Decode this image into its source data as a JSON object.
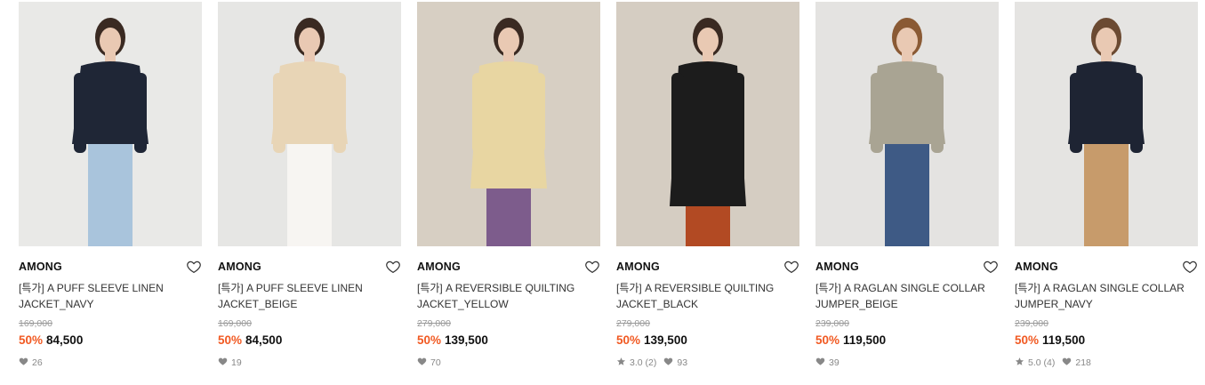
{
  "products": [
    {
      "brand": "AMONG",
      "name_line1": "[특가] A PUFF SLEEVE LINEN",
      "name_line2": "JACKET_NAVY",
      "original_price": "169,000",
      "discount": "50%",
      "price": "84,500",
      "rating": "",
      "likes": "26",
      "bg_color": "#e9e9e7",
      "garment_color": "#1f2636"
    },
    {
      "brand": "AMONG",
      "name_line1": "[특가] A PUFF SLEEVE LINEN",
      "name_line2": "JACKET_BEIGE",
      "original_price": "169,000",
      "discount": "50%",
      "price": "84,500",
      "rating": "",
      "likes": "19",
      "bg_color": "#e6e6e4",
      "garment_color": "#e8d5b6"
    },
    {
      "brand": "AMONG",
      "name_line1": "[특가] A REVERSIBLE QUILTING",
      "name_line2": "JACKET_YELLOW",
      "original_price": "279,000",
      "discount": "50%",
      "price": "139,500",
      "rating": "",
      "likes": "70",
      "bg_color": "#d7cfc3",
      "garment_color": "#e8d6a2"
    },
    {
      "brand": "AMONG",
      "name_line1": "[특가] A REVERSIBLE QUILTING",
      "name_line2": "JACKET_BLACK",
      "original_price": "279,000",
      "discount": "50%",
      "price": "139,500",
      "rating": "3.0 (2)",
      "likes": "93",
      "bg_color": "#d5cdc2",
      "garment_color": "#1c1c1c"
    },
    {
      "brand": "AMONG",
      "name_line1": "[특가] A RAGLAN SINGLE COLLAR",
      "name_line2": "JUMPER_BEIGE",
      "original_price": "239,000",
      "discount": "50%",
      "price": "119,500",
      "rating": "",
      "likes": "39",
      "bg_color": "#e4e3e1",
      "garment_color": "#a9a493"
    },
    {
      "brand": "AMONG",
      "name_line1": "[특가] A RAGLAN SINGLE COLLAR",
      "name_line2": "JUMPER_NAVY",
      "original_price": "239,000",
      "discount": "50%",
      "price": "119,500",
      "rating": "5.0 (4)",
      "likes": "218",
      "bg_color": "#e5e4e2",
      "garment_color": "#1e2433"
    }
  ]
}
